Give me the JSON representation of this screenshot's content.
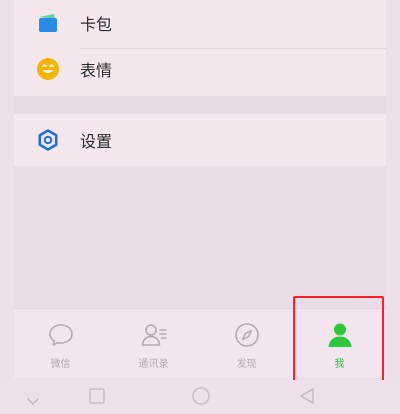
{
  "menu": {
    "items": [
      {
        "label": "卡包",
        "icon": "card-wallet-icon"
      },
      {
        "label": "表情",
        "icon": "emoji-smile-icon"
      },
      {
        "label": "设置",
        "icon": "settings-gear-icon"
      }
    ]
  },
  "tabbar": {
    "tabs": [
      {
        "label": "微信",
        "icon": "chat-bubble-icon",
        "active": false
      },
      {
        "label": "通讯录",
        "icon": "contacts-icon",
        "active": false
      },
      {
        "label": "发现",
        "icon": "compass-icon",
        "active": false
      },
      {
        "label": "我",
        "icon": "person-icon",
        "active": true
      }
    ]
  },
  "system_nav": {
    "buttons": [
      "back-chevron-icon",
      "recent-apps-icon",
      "home-icon",
      "back-triangle-icon"
    ]
  },
  "colors": {
    "accent_green": "#2fc83a",
    "highlight_red": "#ff1f2a",
    "wallet_blue": "#2a8be6",
    "emoji_yellow": "#f5b400",
    "settings_blue": "#1f6fd6"
  }
}
